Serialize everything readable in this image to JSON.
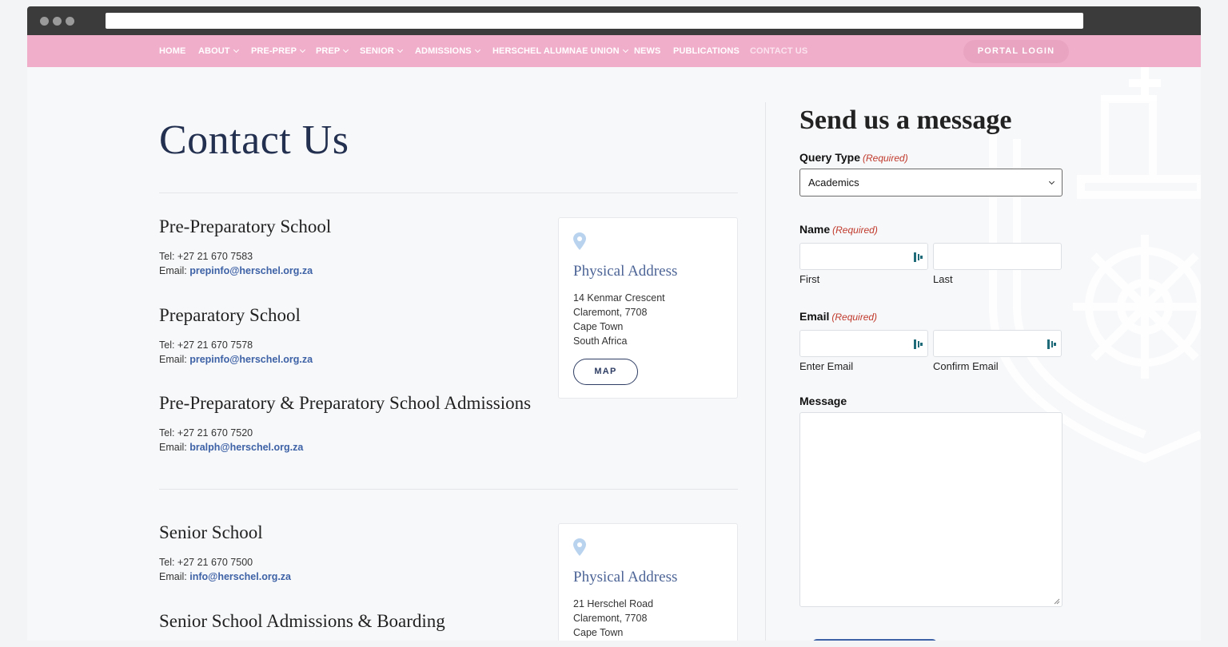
{
  "nav": {
    "items": [
      {
        "label": "HOME",
        "dropdown": false
      },
      {
        "label": "ABOUT",
        "dropdown": true
      },
      {
        "label": "PRE-PREP",
        "dropdown": true
      },
      {
        "label": "PREP",
        "dropdown": true
      },
      {
        "label": "SENIOR",
        "dropdown": true
      },
      {
        "label": "ADMISSIONS",
        "dropdown": true
      },
      {
        "label": "HERSCHEL ALUMNAE UNION",
        "dropdown": true
      },
      {
        "label": "NEWS",
        "dropdown": false
      },
      {
        "label": "PUBLICATIONS",
        "dropdown": false
      },
      {
        "label": "CONTACT US",
        "dropdown": false,
        "active": true
      }
    ],
    "portal_label": "PORTAL LOGIN"
  },
  "main": {
    "title": "Contact Us",
    "schools": [
      {
        "name": "Pre-Preparatory School",
        "tel": "Tel: +27 21 670 7583",
        "email_prefix": "Email:",
        "email": "prepinfo@herschel.org.za"
      },
      {
        "name": "Preparatory School",
        "tel": "Tel: +27 21 670 7578",
        "email_prefix": "Email:",
        "email": "prepinfo@herschel.org.za"
      },
      {
        "name": "Pre-Preparatory & Preparatory School Admissions",
        "tel": "Tel: +27 21 670 7520",
        "email_prefix": "Email:",
        "email": "bralph@herschel.org.za"
      },
      {
        "name": "Senior School",
        "tel": "Tel: +27 21 670 7500",
        "email_prefix": "Email:",
        "email": "info@herschel.org.za"
      },
      {
        "name": "Senior School Admissions & Boarding"
      }
    ],
    "address_cards": [
      {
        "title": "Physical Address",
        "lines": [
          "14 Kenmar Crescent",
          "Claremont, 7708",
          "Cape Town",
          "South Africa"
        ],
        "map_label": "MAP"
      },
      {
        "title": "Physical Address",
        "lines": [
          "21 Herschel Road",
          "Claremont, 7708",
          "Cape Town"
        ]
      }
    ]
  },
  "form": {
    "title": "Send us a message",
    "required_text": "(Required)",
    "query_type": {
      "label": "Query Type",
      "value": "Academics"
    },
    "name": {
      "label": "Name",
      "first": "First",
      "last": "Last"
    },
    "email": {
      "label": "Email",
      "enter": "Enter Email",
      "confirm": "Confirm Email"
    },
    "message": {
      "label": "Message"
    }
  },
  "colors": {
    "nav_bg": "#f0aecb",
    "accent_blue": "#3e62a6",
    "title_navy": "#23304f",
    "required_red": "#c0392b"
  }
}
